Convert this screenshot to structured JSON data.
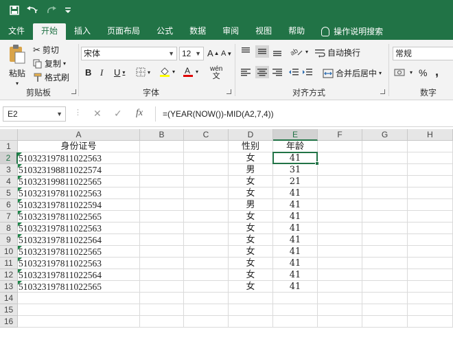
{
  "qat": {
    "save_icon": "save-icon",
    "undo_icon": "undo-icon",
    "redo_icon": "redo-icon",
    "customize_icon": "customize-qat-icon"
  },
  "tabs": [
    {
      "label": "文件"
    },
    {
      "label": "开始"
    },
    {
      "label": "插入"
    },
    {
      "label": "页面布局"
    },
    {
      "label": "公式"
    },
    {
      "label": "数据"
    },
    {
      "label": "审阅"
    },
    {
      "label": "视图"
    },
    {
      "label": "帮助"
    },
    {
      "label": "操作说明搜索"
    }
  ],
  "ribbon": {
    "clipboard": {
      "label": "剪贴板",
      "paste": "粘贴",
      "cut": "剪切",
      "copy": "复制",
      "format_painter": "格式刷"
    },
    "font": {
      "label": "字体",
      "font_name": "宋体",
      "font_size": "12",
      "bold": "B",
      "italic": "I",
      "underline": "U",
      "grow": "A",
      "shrink": "A",
      "phonetic": "wén"
    },
    "alignment": {
      "label": "对齐方式",
      "wrap_text": "自动换行",
      "merge_center": "合并后居中"
    },
    "number": {
      "label": "数字",
      "format": "常规",
      "percent": "%",
      "comma": ","
    }
  },
  "formula_bar": {
    "name_box": "E2",
    "cancel": "✕",
    "enter": "✓",
    "fx": "fx",
    "formula": "=(YEAR(NOW())-MID(A2,7,4))"
  },
  "sheet": {
    "columns": [
      "A",
      "B",
      "C",
      "D",
      "E",
      "F",
      "G",
      "H"
    ],
    "rows": [
      "1",
      "2",
      "3",
      "4",
      "5",
      "6",
      "7",
      "8",
      "9",
      "10",
      "11",
      "12",
      "13",
      "14",
      "15",
      "16"
    ],
    "headers": {
      "A": "身份证号",
      "D": "性别",
      "E": "年龄"
    },
    "data": [
      {
        "id": "510323197811022563",
        "gender": "女",
        "age": "41"
      },
      {
        "id": "510323198811022574",
        "gender": "男",
        "age": "31"
      },
      {
        "id": "510323199811022565",
        "gender": "女",
        "age": "21"
      },
      {
        "id": "510323197811022563",
        "gender": "女",
        "age": "41"
      },
      {
        "id": "510323197811022594",
        "gender": "男",
        "age": "41"
      },
      {
        "id": "510323197811022565",
        "gender": "女",
        "age": "41"
      },
      {
        "id": "510323197811022563",
        "gender": "女",
        "age": "41"
      },
      {
        "id": "510323197811022564",
        "gender": "女",
        "age": "41"
      },
      {
        "id": "510323197811022565",
        "gender": "女",
        "age": "41"
      },
      {
        "id": "510323197811022563",
        "gender": "女",
        "age": "41"
      },
      {
        "id": "510323197811022564",
        "gender": "女",
        "age": "41"
      },
      {
        "id": "510323197811022565",
        "gender": "女",
        "age": "41"
      }
    ],
    "selected_cell": "E2",
    "accent": "#217346"
  }
}
